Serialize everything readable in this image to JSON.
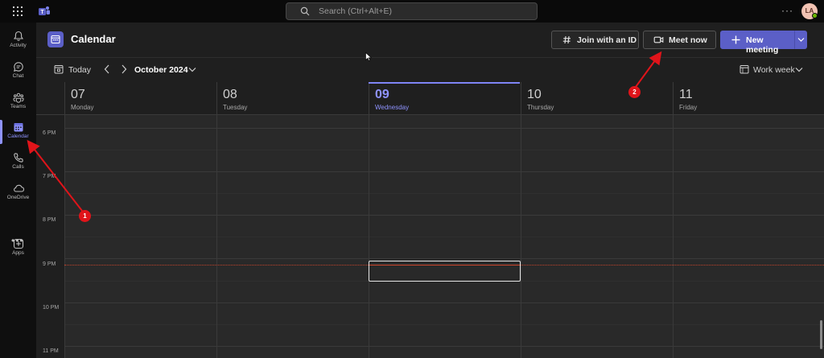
{
  "titlebar": {
    "search_placeholder": "Search (Ctrl+Alt+E)",
    "more": "···",
    "avatar_initials": "LA"
  },
  "rail": {
    "items": [
      {
        "label": "Activity",
        "icon": "bell-icon"
      },
      {
        "label": "Chat",
        "icon": "chat-icon"
      },
      {
        "label": "Teams",
        "icon": "teams-icon"
      },
      {
        "label": "Calendar",
        "icon": "calendar-icon",
        "active": true
      },
      {
        "label": "Calls",
        "icon": "phone-icon"
      },
      {
        "label": "OneDrive",
        "icon": "cloud-icon"
      }
    ],
    "more": "•••",
    "apps_label": "Apps"
  },
  "header": {
    "title": "Calendar",
    "join_label": "Join with an ID",
    "meet_label": "Meet now",
    "new_meeting_label": "New meeting"
  },
  "toolbar": {
    "today_label": "Today",
    "month_label": "October 2024",
    "view_label": "Work week"
  },
  "days": [
    {
      "num": "07",
      "name": "Monday"
    },
    {
      "num": "08",
      "name": "Tuesday"
    },
    {
      "num": "09",
      "name": "Wednesday",
      "today": true
    },
    {
      "num": "10",
      "name": "Thursday"
    },
    {
      "num": "11",
      "name": "Friday"
    }
  ],
  "times": [
    "6 PM",
    "7 PM",
    "8 PM",
    "9 PM",
    "10 PM",
    "11 PM"
  ],
  "annotations": {
    "badge1": "1",
    "badge2": "2"
  },
  "colors": {
    "accent": "#5b5fc7",
    "today": "#8f93ff",
    "now_line": "#d0462c",
    "annotation": "#e0141a"
  }
}
